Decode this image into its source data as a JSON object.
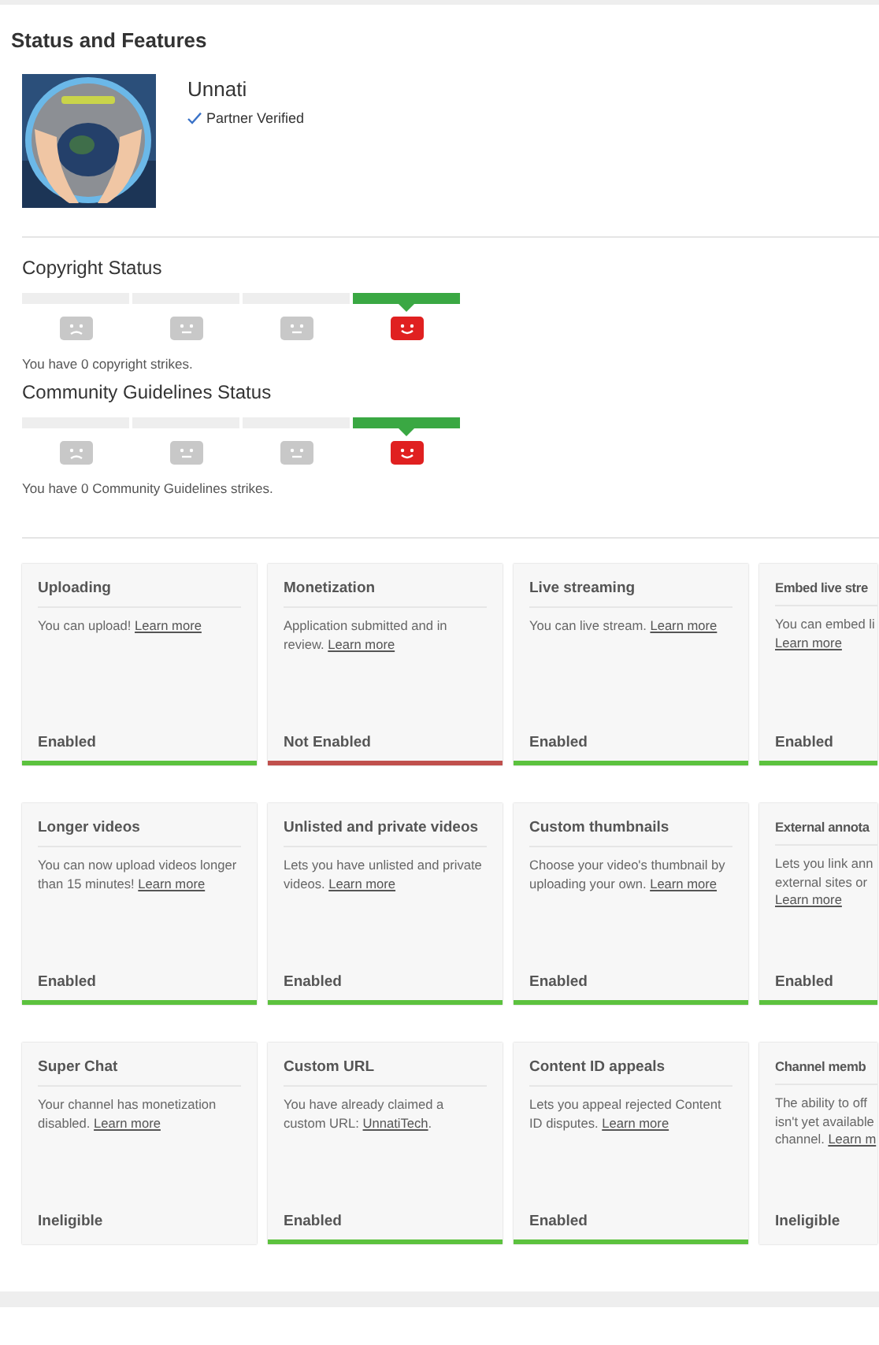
{
  "page_title": "Status and Features",
  "channel": {
    "name": "Unnati",
    "badge": "Partner Verified"
  },
  "strike_sections": [
    {
      "title": "Copyright Status",
      "segments": [
        {
          "kind": "sad",
          "selected": false
        },
        {
          "kind": "neutral",
          "selected": false
        },
        {
          "kind": "neutral",
          "selected": false
        },
        {
          "kind": "happy",
          "selected": true
        }
      ],
      "summary": "You have 0 copyright strikes."
    },
    {
      "title": "Community Guidelines Status",
      "segments": [
        {
          "kind": "sad",
          "selected": false
        },
        {
          "kind": "neutral",
          "selected": false
        },
        {
          "kind": "neutral",
          "selected": false
        },
        {
          "kind": "happy",
          "selected": true
        }
      ],
      "summary": "You have 0 Community Guidelines strikes."
    }
  ],
  "feature_rows": [
    [
      {
        "title": "Uploading",
        "lines": [
          [
            {
              "text": "You can upload! "
            },
            {
              "text": "Learn more",
              "link": true
            }
          ]
        ],
        "status": "Enabled",
        "kind": "enabled"
      },
      {
        "title": "Monetization",
        "lines": [
          [
            {
              "text": "Application submitted and in"
            }
          ],
          [
            {
              "text": "review. "
            },
            {
              "text": "Learn more",
              "link": true
            }
          ]
        ],
        "status": "Not Enabled",
        "kind": "not_enabled"
      },
      {
        "title": "Live streaming",
        "lines": [
          [
            {
              "text": "You can live stream. "
            },
            {
              "text": "Learn more",
              "link": true
            }
          ]
        ],
        "status": "Enabled",
        "kind": "enabled"
      },
      {
        "title": "Embed live stre",
        "lines": [
          [
            {
              "text": "You can embed li"
            }
          ],
          [
            {
              "text": "Learn more",
              "link": true
            }
          ]
        ],
        "status": "Enabled",
        "kind": "enabled"
      }
    ],
    [
      {
        "title": "Longer videos",
        "lines": [
          [
            {
              "text": "You can now upload videos longer"
            }
          ],
          [
            {
              "text": "than 15 minutes! "
            },
            {
              "text": "Learn more",
              "link": true
            }
          ]
        ],
        "status": "Enabled",
        "kind": "enabled"
      },
      {
        "title": "Unlisted and private videos",
        "lines": [
          [
            {
              "text": "Lets you have unlisted and private"
            }
          ],
          [
            {
              "text": "videos. "
            },
            {
              "text": "Learn more",
              "link": true
            }
          ]
        ],
        "status": "Enabled",
        "kind": "enabled"
      },
      {
        "title": "Custom thumbnails",
        "lines": [
          [
            {
              "text": "Choose your video's thumbnail by"
            }
          ],
          [
            {
              "text": "uploading your own. "
            },
            {
              "text": "Learn more",
              "link": true
            }
          ]
        ],
        "status": "Enabled",
        "kind": "enabled"
      },
      {
        "title": "External annota",
        "lines": [
          [
            {
              "text": "Lets you link ann"
            }
          ],
          [
            {
              "text": "external sites or"
            }
          ],
          [
            {
              "text": "Learn more",
              "link": true
            }
          ]
        ],
        "status": "Enabled",
        "kind": "enabled"
      }
    ],
    [
      {
        "title": "Super Chat",
        "lines": [
          [
            {
              "text": "Your channel has monetization"
            }
          ],
          [
            {
              "text": "disabled. "
            },
            {
              "text": "Learn more",
              "link": true
            }
          ]
        ],
        "status": "Ineligible",
        "kind": "ineligible"
      },
      {
        "title": "Custom URL",
        "lines": [
          [
            {
              "text": "You have already claimed a"
            }
          ],
          [
            {
              "text": "custom URL: "
            },
            {
              "text": "UnnatiTech",
              "link": true
            },
            {
              "text": "."
            }
          ]
        ],
        "status": "Enabled",
        "kind": "enabled"
      },
      {
        "title": "Content ID appeals",
        "lines": [
          [
            {
              "text": "Lets you appeal rejected Content"
            }
          ],
          [
            {
              "text": "ID disputes. "
            },
            {
              "text": "Learn more",
              "link": true
            }
          ]
        ],
        "status": "Enabled",
        "kind": "enabled"
      },
      {
        "title": "Channel memb",
        "lines": [
          [
            {
              "text": "The ability to off"
            }
          ],
          [
            {
              "text": "isn't yet available"
            }
          ],
          [
            {
              "text": "channel. "
            },
            {
              "text": "Learn m",
              "link": true
            }
          ]
        ],
        "status": "Ineligible",
        "kind": "ineligible"
      }
    ]
  ]
}
